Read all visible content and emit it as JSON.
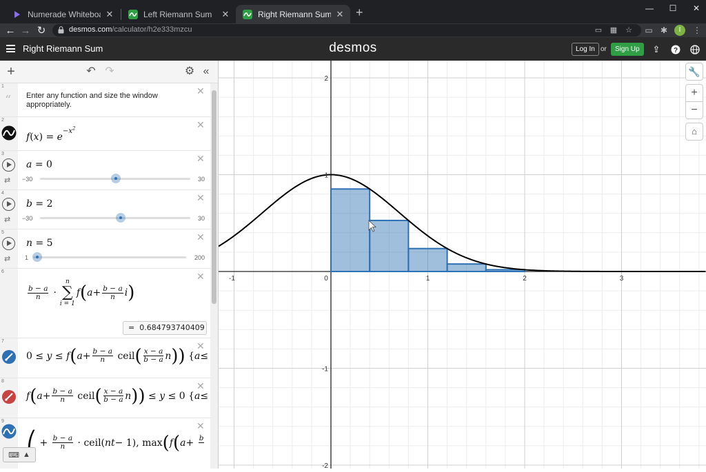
{
  "browser": {
    "tabs": [
      {
        "label": "Numerade Whiteboard",
        "active": false,
        "favicon": "numerade-icon"
      },
      {
        "label": "Left Riemann Sum",
        "active": false,
        "favicon": "desmos-icon"
      },
      {
        "label": "Right Riemann Sum",
        "active": true,
        "favicon": "desmos-icon"
      }
    ],
    "url_host": "desmos.com",
    "url_path": "/calculator/h2e333mzcu",
    "profile_initial": "I"
  },
  "header": {
    "title": "Right Riemann Sum",
    "brand": "desmos",
    "login_label": "Log In",
    "or_label": "or",
    "signup_label": "Sign Up",
    "signup_color": "#2f9e44"
  },
  "expressions": [
    {
      "index": "1",
      "type": "text",
      "text": "Enter any function and size the window appropriately."
    },
    {
      "index": "2",
      "type": "function",
      "latex": "f(x) = e^{-x^2}",
      "color": "#000000"
    },
    {
      "index": "3",
      "type": "slider",
      "lhs": "a",
      "value": "0",
      "min": "−30",
      "max": "30"
    },
    {
      "index": "4",
      "type": "slider",
      "lhs": "b",
      "value": "2",
      "min": "−30",
      "max": "30"
    },
    {
      "index": "5",
      "type": "slider",
      "lhs": "n",
      "value": "5",
      "min": "1",
      "max": "200"
    },
    {
      "index": "6",
      "type": "sum",
      "result_prefix": "=",
      "result": "0.684793740409"
    },
    {
      "index": "7",
      "type": "inequality",
      "color": "#2d70b3"
    },
    {
      "index": "8",
      "type": "inequality",
      "color": "#c74440"
    },
    {
      "index": "9",
      "type": "piecewise",
      "color": "#2d70b3"
    }
  ],
  "graph": {
    "x_tick_labels": [
      "-1",
      "0",
      "1",
      "2",
      "3"
    ],
    "y_tick_labels": [
      "2",
      "1",
      "-1",
      "-2"
    ],
    "rect_fill": "#2d70b3",
    "curve_color": "#000000"
  }
}
